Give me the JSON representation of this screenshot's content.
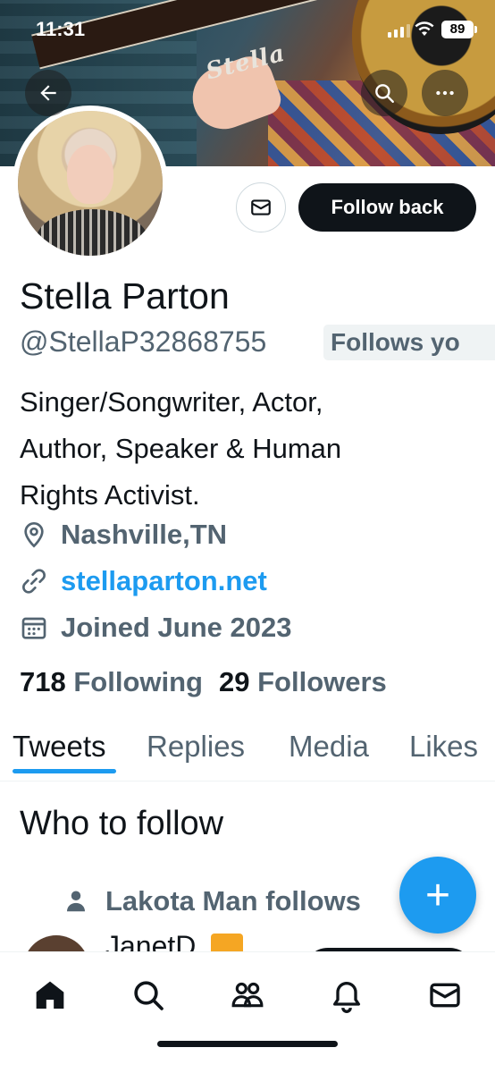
{
  "status_bar": {
    "time": "11:31",
    "battery": "89"
  },
  "profile": {
    "name": "Stella Parton",
    "handle": "@StellaP32868755",
    "follows_badge": "Follows yo",
    "bio_lines": [
      "Singer/Songwriter, Actor,",
      "Author, Speaker & Human",
      "Rights Activist."
    ],
    "location": "Nashville,TN",
    "website": "stellaparton.net",
    "joined": "Joined June 2023",
    "following_count": "718",
    "following_label": "Following",
    "followers_count": "29",
    "followers_label": "Followers",
    "banner_text": "Stella"
  },
  "actions": {
    "follow_back_label": "Follow back"
  },
  "tabs": [
    {
      "label": "Tweets",
      "active": true
    },
    {
      "label": "Replies",
      "active": false
    },
    {
      "label": "Media",
      "active": false
    },
    {
      "label": "Likes",
      "active": false
    }
  ],
  "who_to_follow": {
    "title": "Who to follow",
    "social_context": "Lakota Man follows",
    "partial_user_name": "JanetD"
  },
  "fab": {
    "label": "+"
  },
  "colors": {
    "accent": "#1d9bf0",
    "text": "#0f1419",
    "secondary": "#536471",
    "button_dark": "#0f1419"
  },
  "icons": {
    "back": "arrow-left-icon",
    "search": "search-icon",
    "more": "more-horizontal-icon",
    "message": "envelope-icon",
    "location": "location-pin-icon",
    "link": "link-icon",
    "calendar": "calendar-icon",
    "person": "person-icon",
    "nav": [
      "home-icon",
      "search-icon",
      "communities-icon",
      "bell-icon",
      "mail-icon"
    ]
  }
}
